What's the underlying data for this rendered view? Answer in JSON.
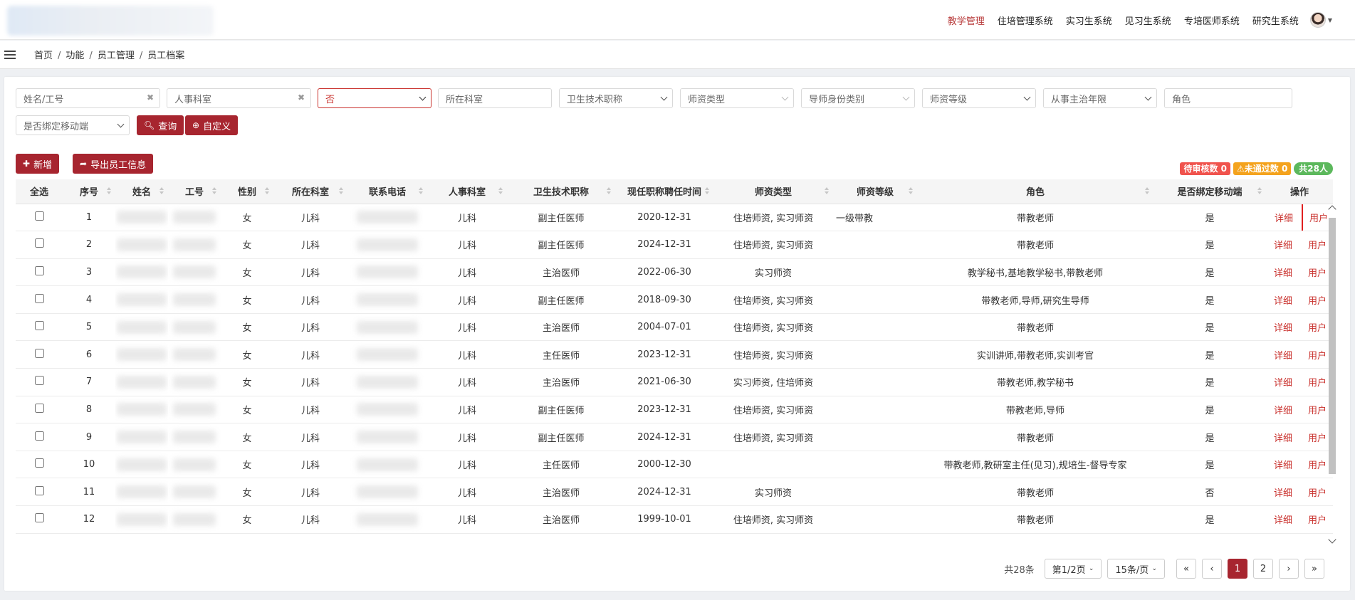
{
  "topnav": {
    "items": [
      "教学管理",
      "住培管理系统",
      "实习生系统",
      "见习生系统",
      "专培医师系统",
      "研究生系统"
    ],
    "active": "教学管理"
  },
  "breadcrumb": [
    "首页",
    "功能",
    "员工管理",
    "员工档案"
  ],
  "filters": {
    "name_id": "姓名/工号",
    "hr_dept": "人事科室",
    "status": "否",
    "dept": "所在科室",
    "title": "卫生技术职称",
    "teacher_type": "师资类型",
    "mentor_category": "导师身份类别",
    "teacher_level": "师资等级",
    "attending_years": "从事主治年限",
    "role": "角色",
    "mobile_bound": "是否绑定移动端"
  },
  "buttons": {
    "query": "查询",
    "custom": "自定义",
    "add": "新增",
    "export": "导出员工信息"
  },
  "badges": {
    "pending": "待审核数 0",
    "rejected": "未通过数 0",
    "total": "共28人"
  },
  "table": {
    "headers": [
      "全选",
      "序号",
      "姓名",
      "工号",
      "性别",
      "所在科室",
      "联系电话",
      "人事科室",
      "卫生技术职称",
      "现任职称聘任时间",
      "师资类型",
      "师资等级",
      "角色",
      "是否绑定移动端",
      "操作"
    ],
    "rows": [
      {
        "no": "1",
        "gender": "女",
        "dept": "儿科",
        "hr": "儿科",
        "title": "副主任医师",
        "date": "2020-12-31",
        "type": "住培师资, 实习师资",
        "level": "一级带教",
        "role": "带教老师",
        "mobile": "是"
      },
      {
        "no": "2",
        "gender": "女",
        "dept": "儿科",
        "hr": "儿科",
        "title": "副主任医师",
        "date": "2024-12-31",
        "type": "住培师资, 实习师资",
        "level": "",
        "role": "带教老师",
        "mobile": "是"
      },
      {
        "no": "3",
        "gender": "女",
        "dept": "儿科",
        "hr": "儿科",
        "title": "主治医师",
        "date": "2022-06-30",
        "type": "实习师资",
        "level": "",
        "role": "教学秘书,基地教学秘书,带教老师",
        "mobile": "是"
      },
      {
        "no": "4",
        "gender": "女",
        "dept": "儿科",
        "hr": "儿科",
        "title": "副主任医师",
        "date": "2018-09-30",
        "type": "住培师资, 实习师资",
        "level": "",
        "role": "带教老师,导师,研究生导师",
        "mobile": "是"
      },
      {
        "no": "5",
        "gender": "女",
        "dept": "儿科",
        "hr": "儿科",
        "title": "主治医师",
        "date": "2004-07-01",
        "type": "住培师资, 实习师资",
        "level": "",
        "role": "带教老师",
        "mobile": "是"
      },
      {
        "no": "6",
        "gender": "女",
        "dept": "儿科",
        "hr": "儿科",
        "title": "主任医师",
        "date": "2023-12-31",
        "type": "住培师资, 实习师资",
        "level": "",
        "role": "实训讲师,带教老师,实训考官",
        "mobile": "是"
      },
      {
        "no": "7",
        "gender": "女",
        "dept": "儿科",
        "hr": "儿科",
        "title": "主治医师",
        "date": "2021-06-30",
        "type": "实习师资, 住培师资",
        "level": "",
        "role": "带教老师,教学秘书",
        "mobile": "是"
      },
      {
        "no": "8",
        "gender": "女",
        "dept": "儿科",
        "hr": "儿科",
        "title": "副主任医师",
        "date": "2023-12-31",
        "type": "住培师资, 实习师资",
        "level": "",
        "role": "带教老师,导师",
        "mobile": "是"
      },
      {
        "no": "9",
        "gender": "女",
        "dept": "儿科",
        "hr": "儿科",
        "title": "副主任医师",
        "date": "2024-12-31",
        "type": "住培师资, 实习师资",
        "level": "",
        "role": "带教老师",
        "mobile": "是"
      },
      {
        "no": "10",
        "gender": "女",
        "dept": "儿科",
        "hr": "儿科",
        "title": "主任医师",
        "date": "2000-12-30",
        "type": "",
        "level": "",
        "role": "带教老师,教研室主任(见习),规培生-督导专家",
        "mobile": "是"
      },
      {
        "no": "11",
        "gender": "女",
        "dept": "儿科",
        "hr": "儿科",
        "title": "主治医师",
        "date": "2024-12-31",
        "type": "实习师资",
        "level": "",
        "role": "带教老师",
        "mobile": "否"
      },
      {
        "no": "12",
        "gender": "女",
        "dept": "儿科",
        "hr": "儿科",
        "title": "主治医师",
        "date": "1999-10-01",
        "type": "住培师资, 实习师资",
        "level": "",
        "role": "带教老师",
        "mobile": "是"
      }
    ],
    "op_detail": "详细",
    "op_user": "用户"
  },
  "pager": {
    "total": "共28条",
    "page_select": "第1/2页",
    "size_select": "15条/页",
    "first": "«",
    "prev": "‹",
    "page1": "1",
    "page2": "2",
    "next": "›",
    "last": "»"
  }
}
